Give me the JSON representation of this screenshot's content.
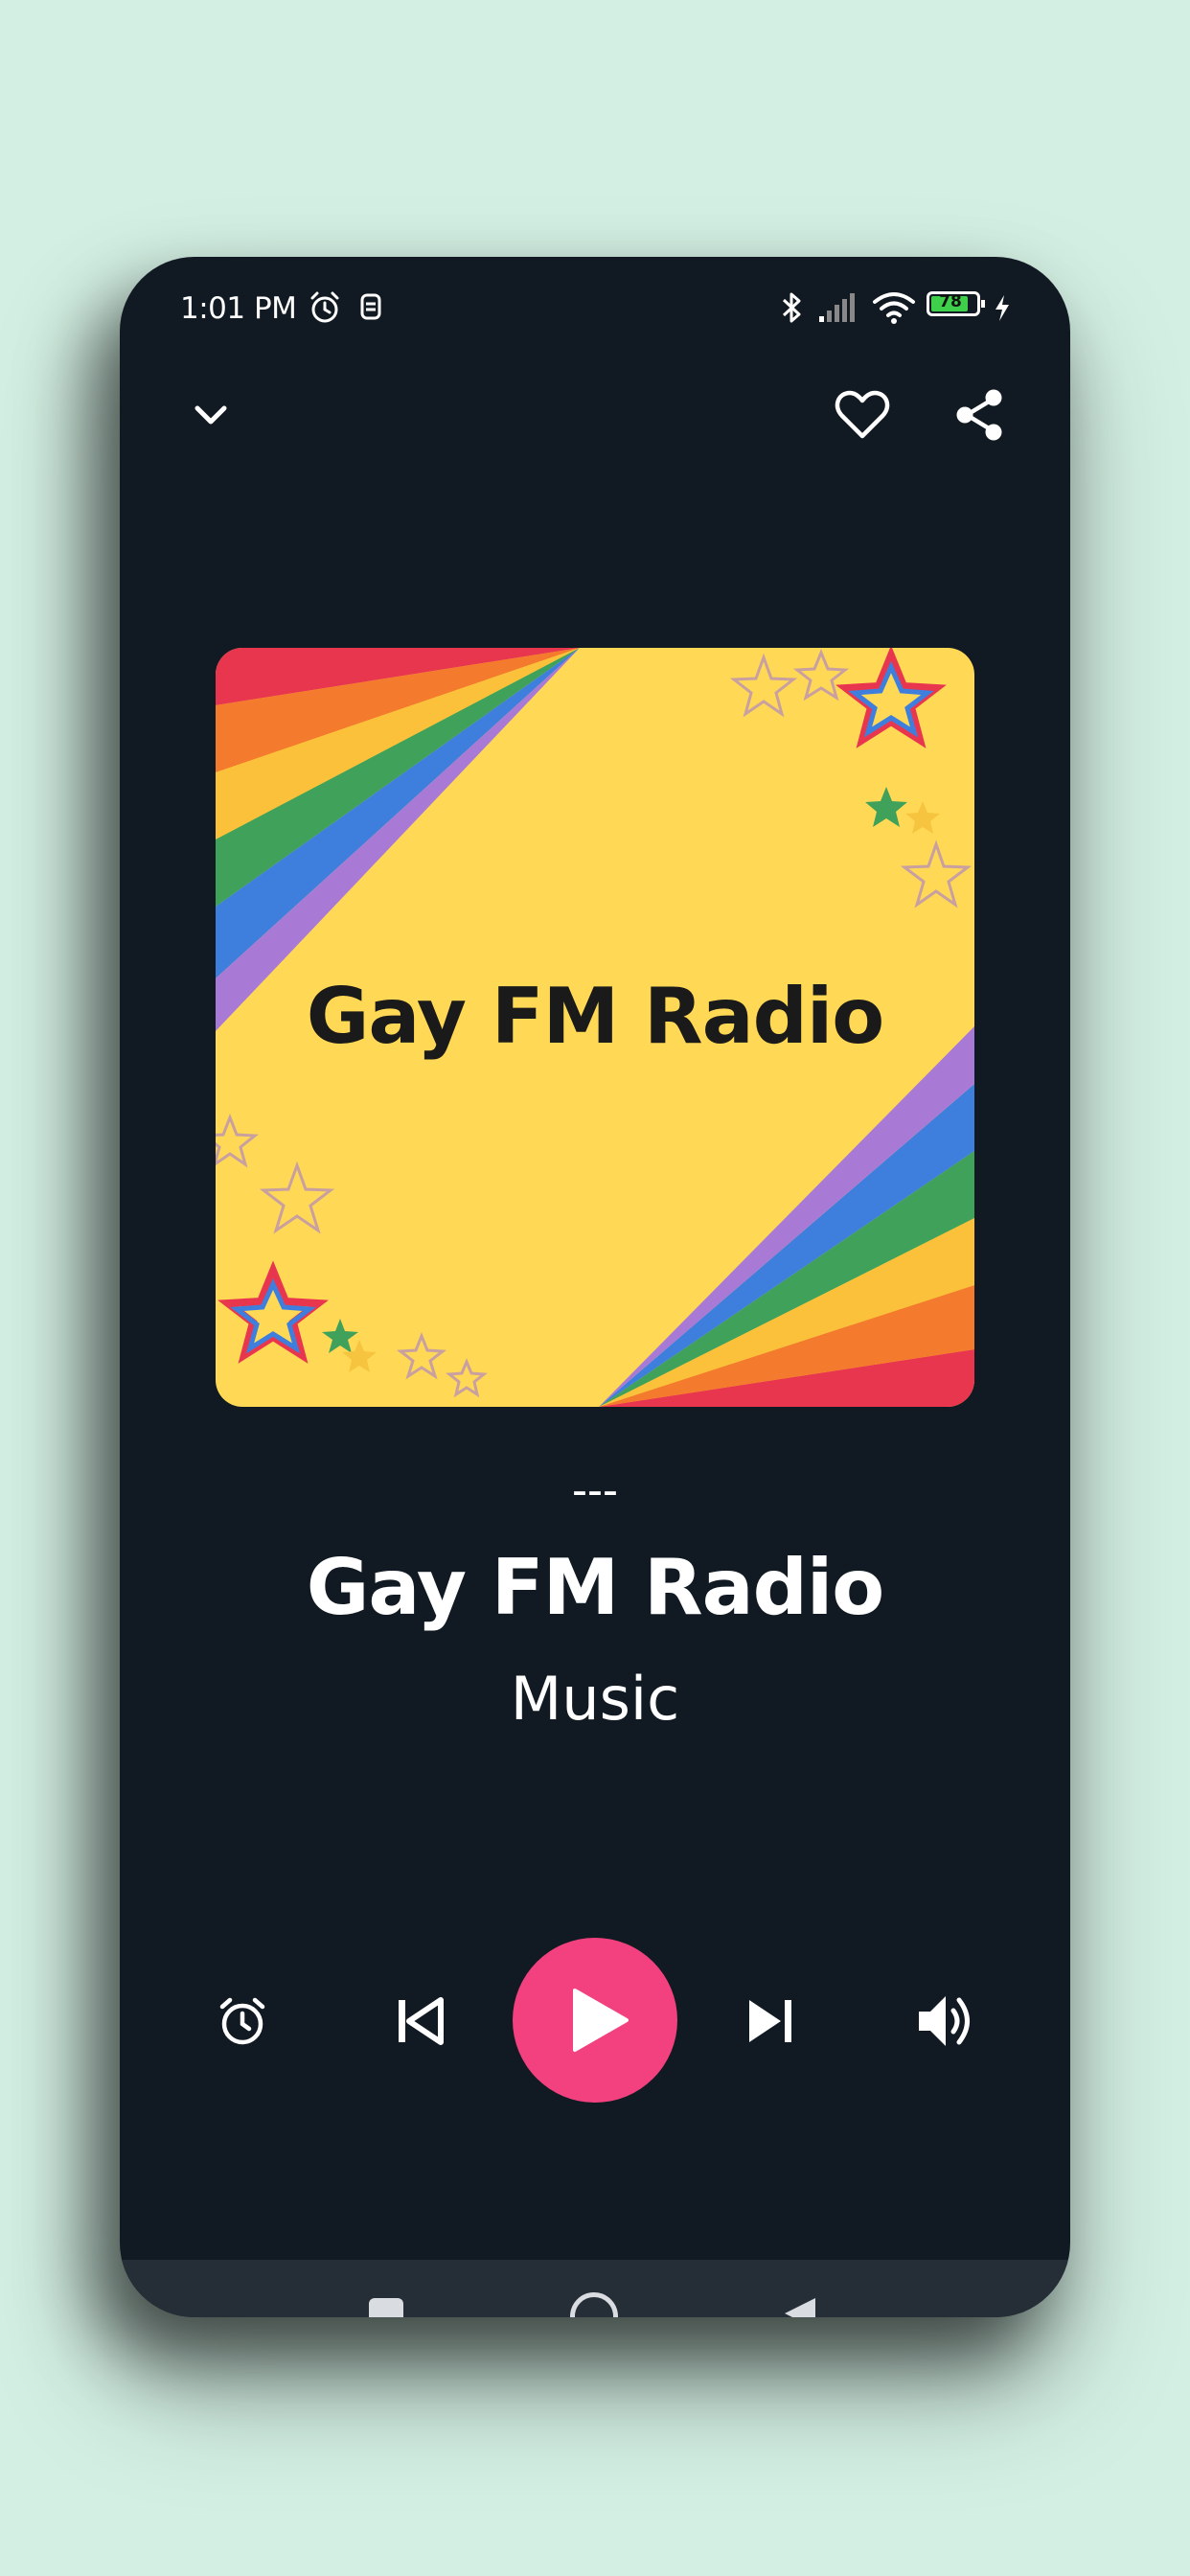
{
  "status_bar": {
    "time": "1:01 PM",
    "battery_level": "78",
    "icons": [
      "alarm-icon",
      "notification-icon",
      "bluetooth-icon",
      "signal-icon",
      "wifi-icon",
      "battery-icon",
      "charging-icon"
    ]
  },
  "top_bar": {
    "icons": [
      "chevron-down-icon",
      "heart-icon",
      "share-icon"
    ]
  },
  "artwork": {
    "title": "Gay FM Radio"
  },
  "now_playing": {
    "track": "---",
    "station": "Gay FM Radio",
    "genre": "Music"
  },
  "controls": {
    "icons": [
      "alarm-clock-icon",
      "skip-previous-icon",
      "play-icon",
      "skip-next-icon",
      "volume-icon"
    ]
  },
  "colors": {
    "background": "#d3efe3",
    "phone_bg": "#111a22",
    "accent": "#f2417e",
    "nav_bar": "#252d36",
    "artwork_bg": "#ffd955"
  }
}
